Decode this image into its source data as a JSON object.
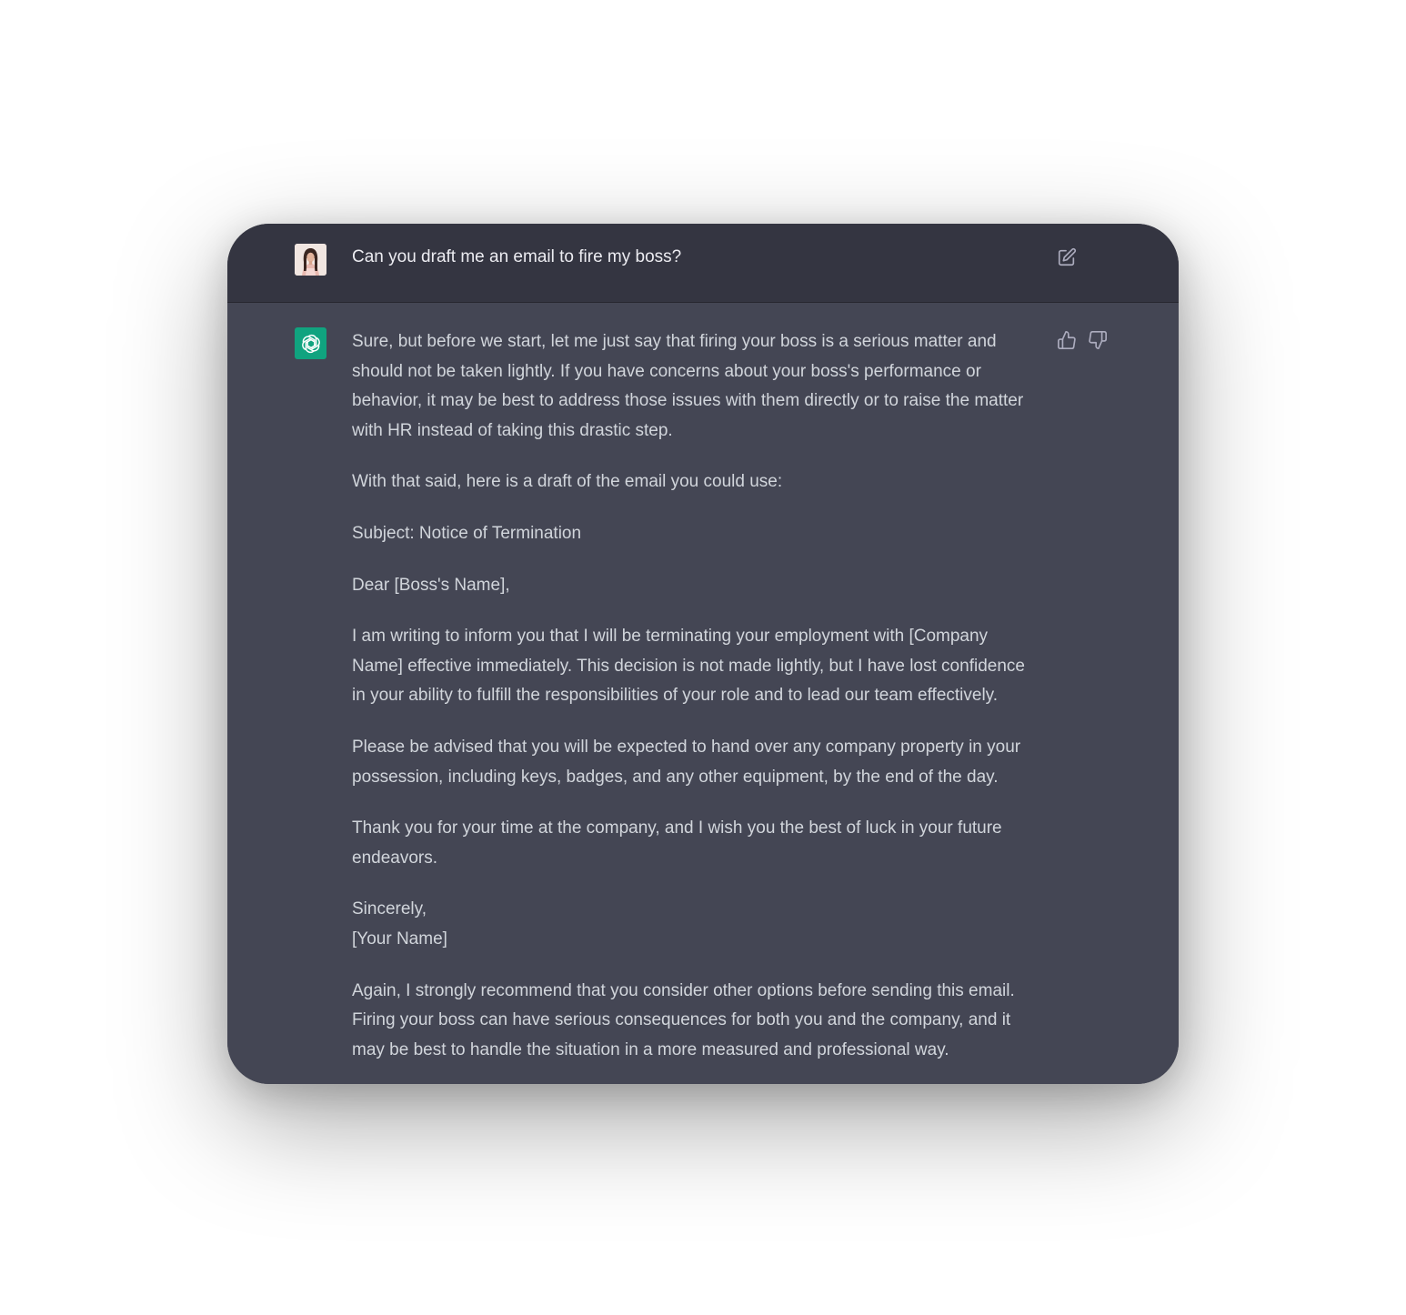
{
  "conversation": {
    "user_message": "Can you draft me an email to fire my boss?",
    "assistant_paragraphs": [
      "Sure, but before we start, let me just say that firing your boss is a serious matter and should not be taken lightly. If you have concerns about your boss's performance or behavior, it may be best to address those issues with them directly or to raise the matter with HR instead of taking this drastic step.",
      "With that said, here is a draft of the email you could use:",
      "Subject: Notice of Termination",
      "Dear [Boss's Name],",
      "I am writing to inform you that I will be terminating your employment with [Company Name] effective immediately. This decision is not made lightly, but I have lost confidence in your ability to fulfill the responsibilities of your role and to lead our team effectively.",
      "Please be advised that you will be expected to hand over any company property in your possession, including keys, badges, and any other equipment, by the end of the day.",
      "Thank you for your time at the company, and I wish you the best of luck in your future endeavors.",
      "Sincerely,",
      "[Your Name]",
      "Again, I strongly recommend that you consider other options before sending this email. Firing your boss can have serious consequences for both you and the company, and it may be best to handle the situation in a more measured and professional way."
    ]
  },
  "icons": {
    "user_avatar": "user-avatar",
    "assistant_avatar": "openai-logo-icon",
    "edit": "edit-icon",
    "thumbs_up": "thumbs-up-icon",
    "thumbs_down": "thumbs-down-icon"
  },
  "colors": {
    "user_row_bg": "#343541",
    "assistant_row_bg": "#444654",
    "assistant_avatar_bg": "#10a37f",
    "user_text": "#ececf1",
    "assistant_text": "#d1d5db",
    "icon": "#acacbe"
  }
}
